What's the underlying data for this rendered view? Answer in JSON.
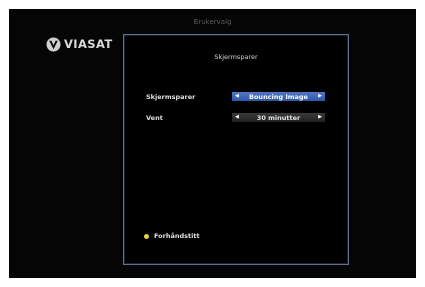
{
  "header": {
    "title": "Brukervalg"
  },
  "logo": {
    "text": "VIASAT",
    "icon": "viasat-v-logo-icon"
  },
  "panel": {
    "title": "Skjermsparer",
    "settings": [
      {
        "label": "Skjermsparer",
        "value": "Bouncing Image",
        "selected": true
      },
      {
        "label": "Vent",
        "value": "30 minutter",
        "selected": false
      }
    ],
    "hint": {
      "label": "Forhåndstitt",
      "color": "#e8d140",
      "icon": "yellow-button-dot-icon"
    }
  },
  "colors": {
    "active_selector": "#3f67b8",
    "panel_border": "#5e7290",
    "background": "#050505"
  }
}
